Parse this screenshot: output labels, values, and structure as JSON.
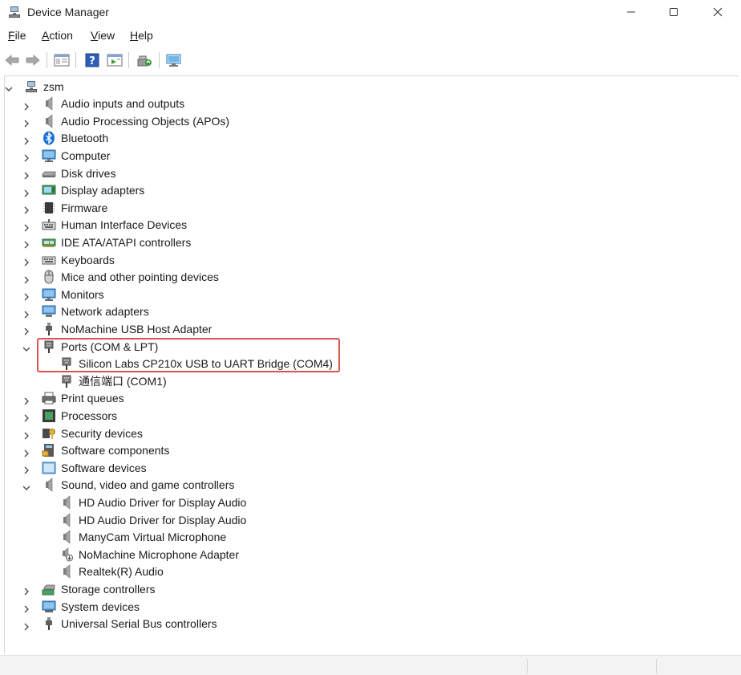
{
  "window": {
    "title": "Device Manager",
    "controls": {
      "minimize": "minimize",
      "maximize": "maximize",
      "close": "close"
    }
  },
  "menu": [
    {
      "label": "File",
      "accel": "F",
      "rest": "ile"
    },
    {
      "label": "Action",
      "accel": "A",
      "rest": "ction"
    },
    {
      "label": "View",
      "accel": "V",
      "rest": "iew"
    },
    {
      "label": "Help",
      "accel": "H",
      "rest": "elp"
    }
  ],
  "toolbar": [
    "back-icon",
    "forward-icon",
    "properties-icon",
    "help-icon",
    "update-driver-icon",
    "uninstall-icon",
    "scan-hardware-icon"
  ],
  "tree": {
    "root": "zsm",
    "categories": [
      {
        "label": "Audio inputs and outputs",
        "icon": "speaker-icon",
        "expanded": false
      },
      {
        "label": "Audio Processing Objects (APOs)",
        "icon": "speaker-icon",
        "expanded": false
      },
      {
        "label": "Bluetooth",
        "icon": "bluetooth-icon",
        "expanded": false
      },
      {
        "label": "Computer",
        "icon": "computer-icon",
        "expanded": false
      },
      {
        "label": "Disk drives",
        "icon": "disk-drive-icon",
        "expanded": false
      },
      {
        "label": "Display adapters",
        "icon": "display-adapter-icon",
        "expanded": false
      },
      {
        "label": "Firmware",
        "icon": "firmware-icon",
        "expanded": false
      },
      {
        "label": "Human Interface Devices",
        "icon": "hid-icon",
        "expanded": false
      },
      {
        "label": "IDE ATA/ATAPI controllers",
        "icon": "ide-controller-icon",
        "expanded": false
      },
      {
        "label": "Keyboards",
        "icon": "keyboard-icon",
        "expanded": false
      },
      {
        "label": "Mice and other pointing devices",
        "icon": "mouse-icon",
        "expanded": false
      },
      {
        "label": "Monitors",
        "icon": "monitor-icon",
        "expanded": false
      },
      {
        "label": "Network adapters",
        "icon": "network-adapter-icon",
        "expanded": false
      },
      {
        "label": "NoMachine USB Host Adapter",
        "icon": "usb-plug-icon",
        "expanded": false
      },
      {
        "label": "Ports (COM & LPT)",
        "icon": "port-icon",
        "expanded": true,
        "children": [
          {
            "label": "Silicon Labs CP210x USB to UART Bridge (COM4)",
            "icon": "port-icon"
          },
          {
            "label": "通信端口 (COM1)",
            "icon": "port-icon"
          }
        ]
      },
      {
        "label": "Print queues",
        "icon": "printer-icon",
        "expanded": false
      },
      {
        "label": "Processors",
        "icon": "processor-icon",
        "expanded": false
      },
      {
        "label": "Security devices",
        "icon": "security-device-icon",
        "expanded": false
      },
      {
        "label": "Software components",
        "icon": "software-component-icon",
        "expanded": false
      },
      {
        "label": "Software devices",
        "icon": "software-device-icon",
        "expanded": false
      },
      {
        "label": "Sound, video and game controllers",
        "icon": "speaker-icon",
        "expanded": true,
        "children": [
          {
            "label": "HD Audio Driver for Display Audio",
            "icon": "speaker-icon"
          },
          {
            "label": "HD Audio Driver for Display Audio",
            "icon": "speaker-icon"
          },
          {
            "label": "ManyCam Virtual Microphone",
            "icon": "speaker-icon"
          },
          {
            "label": "NoMachine Microphone Adapter",
            "icon": "speaker-download-icon"
          },
          {
            "label": "Realtek(R) Audio",
            "icon": "speaker-icon"
          }
        ]
      },
      {
        "label": "Storage controllers",
        "icon": "storage-controller-icon",
        "expanded": false
      },
      {
        "label": "System devices",
        "icon": "system-device-icon",
        "expanded": false
      },
      {
        "label": "Universal Serial Bus controllers",
        "icon": "usb-plug-icon",
        "expanded": false
      }
    ]
  },
  "colors": {
    "highlight": "#d9534f",
    "accent": "#2a7ad2"
  }
}
